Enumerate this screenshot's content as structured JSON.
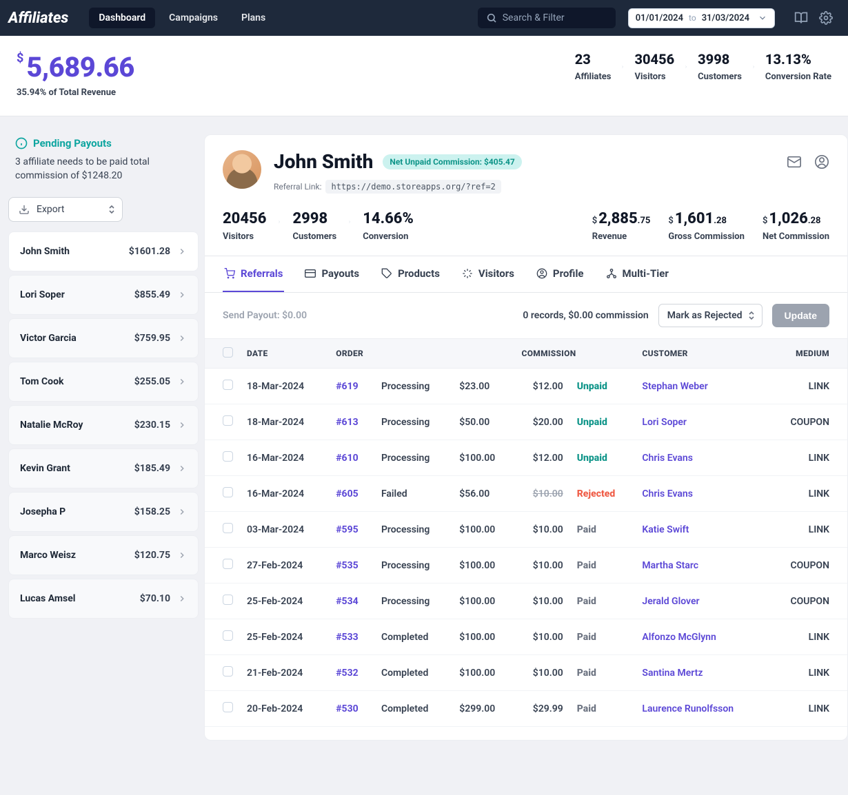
{
  "topbar": {
    "logo": "Affiliates",
    "nav": [
      "Dashboard",
      "Campaigns",
      "Plans"
    ],
    "active_nav": 0,
    "search_placeholder": "Search & Filter",
    "date_from": "01/01/2024",
    "date_to_label": "to",
    "date_to": "31/03/2024"
  },
  "summary": {
    "currency": "$",
    "revenue": "5,689.66",
    "revenue_sub": "35.94% of Total Revenue",
    "metrics": [
      {
        "value": "23",
        "label": "Affiliates"
      },
      {
        "value": "30456",
        "label": "Visitors"
      },
      {
        "value": "3998",
        "label": "Customers"
      },
      {
        "value": "13.13%",
        "label": "Conversion Rate"
      }
    ]
  },
  "sidebar": {
    "pending_title": "Pending Payouts",
    "pending_text": "3 affiliate needs to be paid total commission of $1248.20",
    "export_label": "Export",
    "affiliates": [
      {
        "name": "John Smith",
        "amount": "$1601.28"
      },
      {
        "name": "Lori Soper",
        "amount": "$855.49"
      },
      {
        "name": "Victor Garcia",
        "amount": "$759.95"
      },
      {
        "name": "Tom Cook",
        "amount": "$255.05"
      },
      {
        "name": "Natalie McRoy",
        "amount": "$230.15"
      },
      {
        "name": "Kevin Grant",
        "amount": "$185.49"
      },
      {
        "name": "Josepha P",
        "amount": "$158.25"
      },
      {
        "name": "Marco Weisz",
        "amount": "$120.75"
      },
      {
        "name": "Lucas Amsel",
        "amount": "$70.10"
      }
    ],
    "active_affiliate": 0
  },
  "profile": {
    "name": "John Smith",
    "badge": "Net Unpaid Commission: $405.47",
    "referral_label": "Referral Link:",
    "referral_url": "https://demo.storeapps.org/?ref=2",
    "stats_left": [
      {
        "value": "20456",
        "label": "Visitors"
      },
      {
        "value": "2998",
        "label": "Customers"
      },
      {
        "value": "14.66%",
        "label": "Conversion"
      }
    ],
    "stats_right": [
      {
        "currency": "$",
        "whole": "2,885",
        "cents": ".75",
        "label": "Revenue"
      },
      {
        "currency": "$",
        "whole": "1,601",
        "cents": ".28",
        "label": "Gross Commission"
      },
      {
        "currency": "$",
        "whole": "1,026",
        "cents": ".28",
        "label": "Net Commission"
      }
    ]
  },
  "tabs": {
    "items": [
      "Referrals",
      "Payouts",
      "Products",
      "Visitors",
      "Profile",
      "Multi-Tier"
    ],
    "active": 0
  },
  "controls": {
    "send_payout": "Send Payout: $0.00",
    "records_info": "0 records, $0.00 commission",
    "mark_as": "Mark as Rejected",
    "update": "Update"
  },
  "table": {
    "headers": [
      "",
      "DATE",
      "ORDER",
      "",
      "",
      "COMMISSION",
      "",
      "CUSTOMER",
      "MEDIUM"
    ],
    "rows": [
      {
        "date": "18-Mar-2024",
        "order": "#619",
        "order_status": "Processing",
        "amount": "$23.00",
        "commission": "$12.00",
        "status": "Unpaid",
        "status_class": "unpaid",
        "customer": "Stephan Weber",
        "medium": "LINK"
      },
      {
        "date": "18-Mar-2024",
        "order": "#613",
        "order_status": "Processing",
        "amount": "$50.00",
        "commission": "$20.00",
        "status": "Unpaid",
        "status_class": "unpaid",
        "customer": "Lori Soper",
        "medium": "COUPON"
      },
      {
        "date": "16-Mar-2024",
        "order": "#610",
        "order_status": "Processing",
        "amount": "$100.00",
        "commission": "$12.00",
        "status": "Unpaid",
        "status_class": "unpaid",
        "customer": "Chris Evans",
        "medium": "LINK"
      },
      {
        "date": "16-Mar-2024",
        "order": "#605",
        "order_status": "Failed",
        "amount": "$56.00",
        "commission": "$10.00",
        "strike": true,
        "status": "Rejected",
        "status_class": "rejected",
        "customer": "Chris Evans",
        "medium": "LINK"
      },
      {
        "date": "03-Mar-2024",
        "order": "#595",
        "order_status": "Processing",
        "amount": "$100.00",
        "commission": "$10.00",
        "status": "Paid",
        "status_class": "paid",
        "customer": "Katie Swift",
        "medium": "LINK"
      },
      {
        "date": "27-Feb-2024",
        "order": "#535",
        "order_status": "Processing",
        "amount": "$100.00",
        "commission": "$10.00",
        "status": "Paid",
        "status_class": "paid",
        "customer": "Martha Starc",
        "medium": "COUPON"
      },
      {
        "date": "25-Feb-2024",
        "order": "#534",
        "order_status": "Processing",
        "amount": "$100.00",
        "commission": "$10.00",
        "status": "Paid",
        "status_class": "paid",
        "customer": "Jerald Glover",
        "medium": "COUPON"
      },
      {
        "date": "25-Feb-2024",
        "order": "#533",
        "order_status": "Completed",
        "amount": "$100.00",
        "commission": "$10.00",
        "status": "Paid",
        "status_class": "paid",
        "customer": "Alfonzo McGlynn",
        "medium": "LINK"
      },
      {
        "date": "21-Feb-2024",
        "order": "#532",
        "order_status": "Completed",
        "amount": "$100.00",
        "commission": "$10.00",
        "status": "Paid",
        "status_class": "paid",
        "customer": "Santina Mertz",
        "medium": "LINK"
      },
      {
        "date": "20-Feb-2024",
        "order": "#530",
        "order_status": "Completed",
        "amount": "$299.00",
        "commission": "$29.99",
        "status": "Paid",
        "status_class": "paid",
        "customer": "Laurence Runolfsson",
        "medium": "LINK"
      }
    ]
  }
}
